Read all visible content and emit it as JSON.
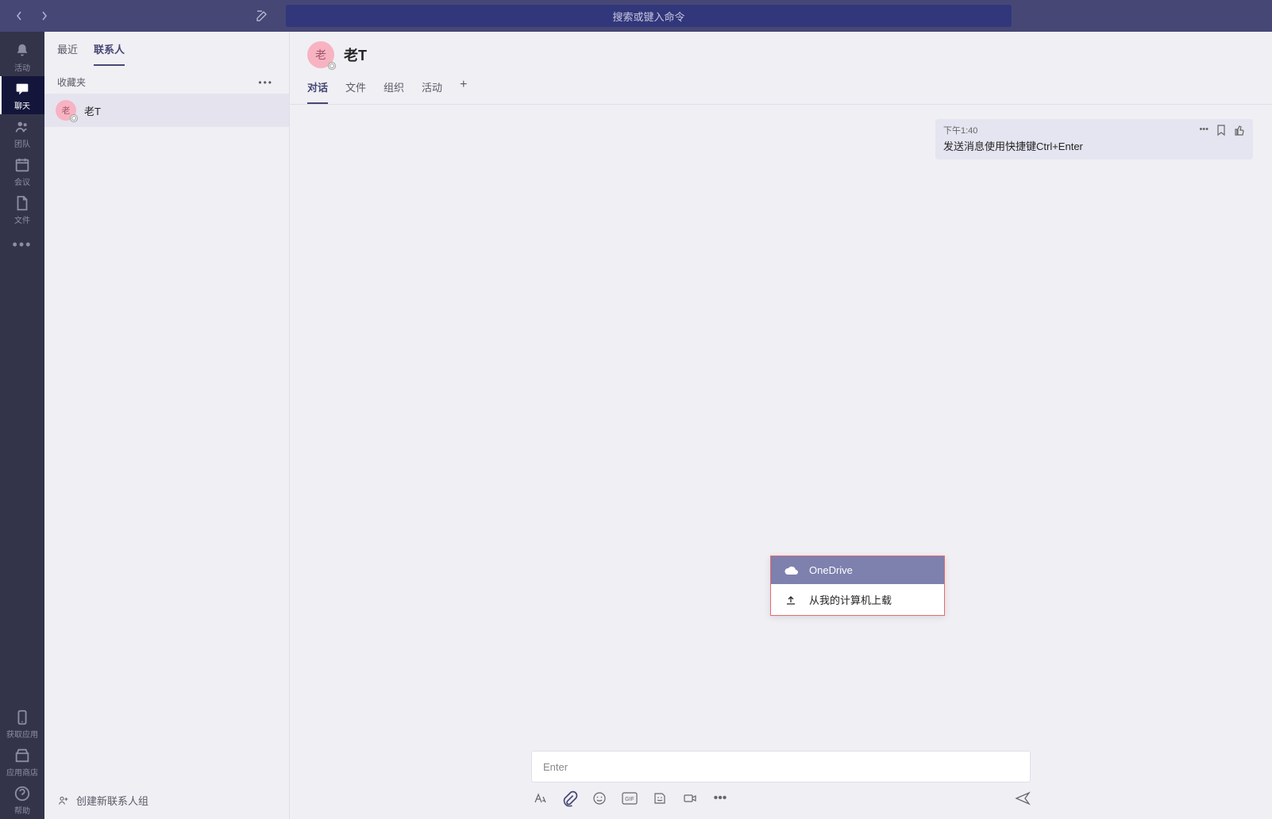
{
  "titlebar": {
    "search_placeholder": "搜索或键入命令"
  },
  "rail": {
    "activity": "活动",
    "chat": "聊天",
    "teams": "团队",
    "meetings": "会议",
    "files": "文件",
    "get_app": "获取应用",
    "app_store": "应用商店",
    "help": "帮助"
  },
  "list": {
    "tabs": {
      "recent": "最近",
      "contacts": "联系人"
    },
    "section_favorites": "收藏夹",
    "contact1": {
      "avatar": "老",
      "name": "老T"
    },
    "footer": "创建新联系人组"
  },
  "chat": {
    "avatar": "老",
    "title": "老T",
    "tabs": {
      "conversation": "对话",
      "files": "文件",
      "org": "组织",
      "activity": "活动"
    },
    "message1": {
      "time": "下午1:40",
      "text": "发送消息使用快捷键Ctrl+Enter"
    }
  },
  "attach_menu": {
    "onedrive": "OneDrive",
    "upload": "从我的计算机上载"
  },
  "composer": {
    "placeholder_suffix": "Enter"
  }
}
